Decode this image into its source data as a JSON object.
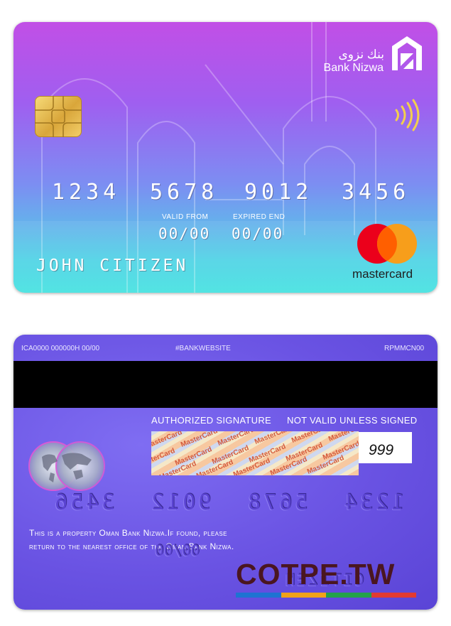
{
  "front": {
    "bank_name_ar": "بنك نزوى",
    "bank_name_en": "Bank Nizwa",
    "card_number": [
      "1234",
      "5678",
      "9012",
      "3456"
    ],
    "valid_from_label": "VALID FROM",
    "expired_end_label": "EXPIRED END",
    "valid_from": "00/00",
    "expired_end": "00/00",
    "cardholder": "JOHN CITIZEN",
    "network": "mastercard",
    "icons": [
      "bank-nizwa-logo",
      "emv-chip",
      "contactless-icon",
      "mastercard-logo"
    ]
  },
  "back": {
    "top_left": "ICA0000 000000H 00/00",
    "top_center": "#BANKWEBSITE",
    "top_right": "RPMMCN00",
    "authorized_signature": "AUTHORIZED SIGNATURE",
    "not_valid": "NOT VALID UNLESS SIGNED",
    "signature_pattern_text": "MasterCard",
    "cvv": "999",
    "embossed_number": [
      "3456",
      "9012",
      "5678",
      "1234"
    ],
    "embossed_date": "00/00",
    "embossed_name": "CITIZEN",
    "disclaimer_line1": "This is a property Oman Bank Nizwa.If found, please",
    "disclaimer_line2": "return to the nearest office of the Oman Bank Nizwa."
  },
  "watermark": {
    "text": "COTPE.TW",
    "bar_colors": [
      "#1e73d2",
      "#f0a21a",
      "#23a24a",
      "#e23a32"
    ]
  },
  "colors": {
    "front_gradient_top": "#c14fe6",
    "front_gradient_bottom": "#45e2e0",
    "back_bg": "#6a53e3",
    "mastercard_red": "#eb001b",
    "mastercard_orange": "#f79e1b"
  }
}
